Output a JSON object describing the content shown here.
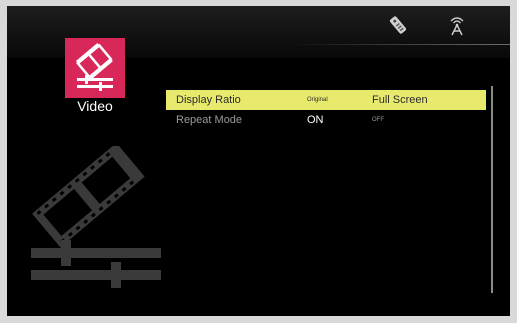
{
  "category": {
    "label": "Video",
    "icon": "video-settings-icon",
    "tile_color": "#d8285a"
  },
  "status_icons": [
    {
      "name": "remote-icon"
    },
    {
      "name": "antenna-icon"
    }
  ],
  "settings": [
    {
      "label": "Display Ratio",
      "options": [
        "Original",
        "Full Screen"
      ],
      "selected": true
    },
    {
      "label": "Repeat Mode",
      "options": [
        "ON",
        "OFF"
      ],
      "selected": false
    }
  ],
  "colors": {
    "highlight": "#e8ea6d",
    "accent": "#d8285a",
    "background": "#000000"
  }
}
